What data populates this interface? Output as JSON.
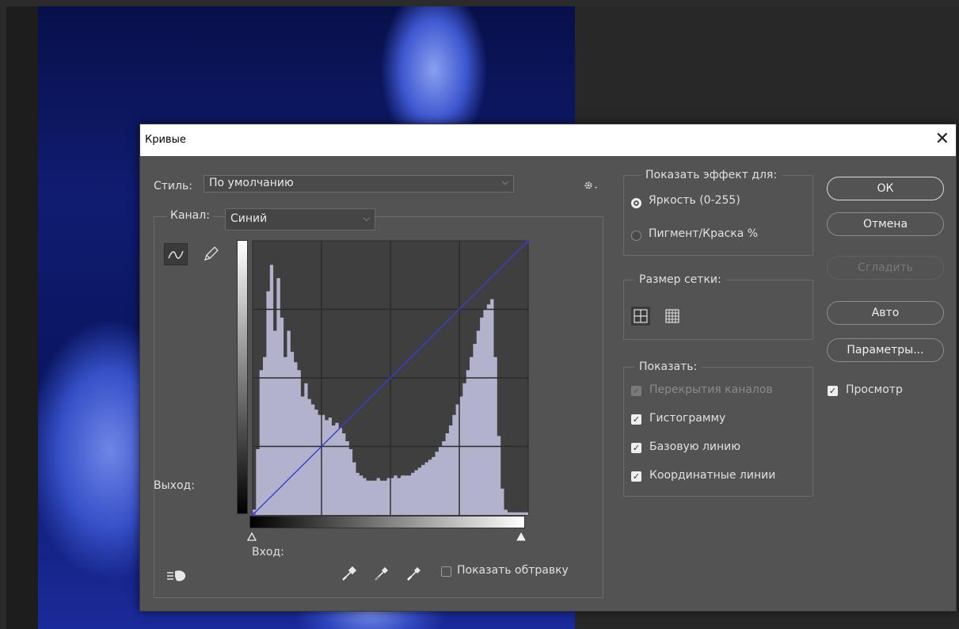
{
  "dialog": {
    "title": "Кривые",
    "style_label": "Стиль:",
    "style_value": "По умолчанию",
    "channel_label": "Канал:",
    "channel_value": "Синий",
    "output_label": "Выход:",
    "input_label": "Вход:",
    "show_clipping_label": "Показать обтравку",
    "show_clipping_checked": false
  },
  "show_effect": {
    "title": "Показать эффект для:",
    "options": [
      {
        "label": "Яркость (0-255)",
        "selected": true
      },
      {
        "label": "Пигмент/Краска %",
        "selected": false
      }
    ]
  },
  "grid_size": {
    "title": "Размер сетки:",
    "options": [
      "simple-grid-icon",
      "detailed-grid-icon"
    ],
    "selected": "simple-grid-icon"
  },
  "show": {
    "title": "Показать:",
    "items": [
      {
        "label": "Перекрытия каналов",
        "checked": true,
        "enabled": false
      },
      {
        "label": "Гистограмму",
        "checked": true,
        "enabled": true
      },
      {
        "label": "Базовую линию",
        "checked": true,
        "enabled": true
      },
      {
        "label": "Координатные линии",
        "checked": true,
        "enabled": true
      }
    ]
  },
  "buttons": {
    "ok": "ОК",
    "cancel": "Отмена",
    "smooth": "Сгладить",
    "auto": "Авто",
    "options": "Параметры..."
  },
  "preview": {
    "label": "Просмотр",
    "checked": true
  },
  "curve": {
    "channel_color": "#3b3bd9",
    "histogram_color": "#b2b2cc",
    "points": [
      [
        0,
        0
      ],
      [
        255,
        255
      ]
    ],
    "histogram": [
      0.02,
      0.25,
      0.55,
      0.6,
      0.85,
      0.95,
      0.7,
      0.9,
      0.75,
      0.6,
      0.7,
      0.62,
      0.58,
      0.55,
      0.45,
      0.5,
      0.44,
      0.42,
      0.4,
      0.38,
      0.38,
      0.36,
      0.37,
      0.34,
      0.35,
      0.33,
      0.31,
      0.28,
      0.25,
      0.2,
      0.16,
      0.15,
      0.14,
      0.13,
      0.13,
      0.13,
      0.14,
      0.13,
      0.13,
      0.14,
      0.14,
      0.15,
      0.14,
      0.15,
      0.15,
      0.15,
      0.16,
      0.17,
      0.18,
      0.19,
      0.2,
      0.21,
      0.22,
      0.24,
      0.26,
      0.28,
      0.31,
      0.34,
      0.38,
      0.42,
      0.45,
      0.5,
      0.55,
      0.6,
      0.65,
      0.7,
      0.75,
      0.78,
      0.8,
      0.82,
      0.6,
      0.3,
      0.1,
      0.02,
      0.01,
      0.01,
      0.01,
      0.01,
      0.01,
      0.01
    ],
    "selected_tool": "curve-tool"
  }
}
